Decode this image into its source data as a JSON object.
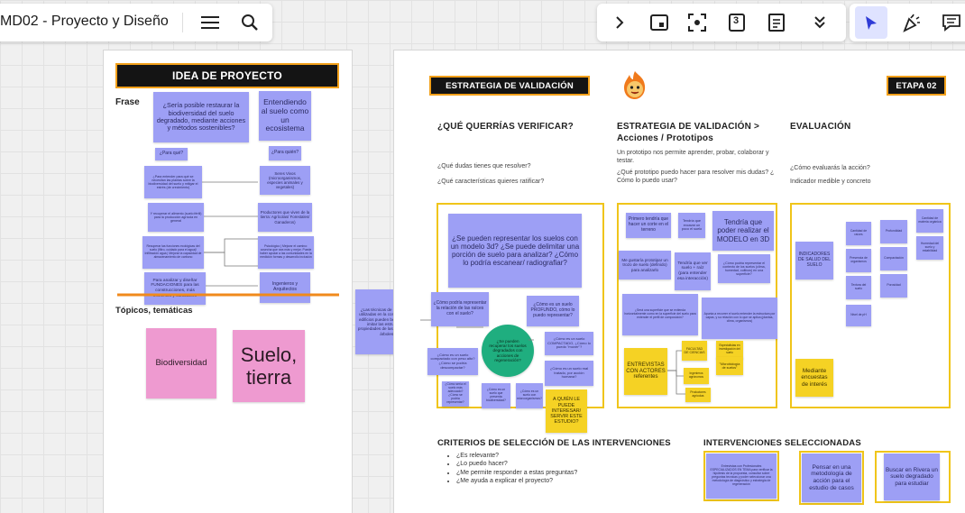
{
  "topbar": {
    "title": "MD02 - Proyecto y Diseño",
    "menu_icon": "hamburger-icon",
    "search_icon": "search-icon"
  },
  "toolbar": {
    "icons": [
      "chevron-right-icon",
      "frame-icon",
      "focus-icon",
      "counter-icon",
      "notes-icon",
      "double-chevron-down-icon",
      "select-cursor-icon",
      "celebrate-icon",
      "comments-icon"
    ],
    "counter_value": "3",
    "active_color": "#dfe3ff"
  },
  "colors": {
    "sticky_purple": "#9d9ff5",
    "sticky_yellow": "#f5d224",
    "sticky_pink": "#ee9ad0",
    "frame_border": "#f0c51a",
    "header_bg": "#141414",
    "header_border": "#f2a01a",
    "orange_line": "#f08a1c"
  },
  "left_frame": {
    "header": "IDEA DE PROYECTO",
    "frase_label": "Frase",
    "main_question": "¿Sería posible restaurar la biodiversidad del suelo degradado, mediante acciones y métodos sostenibles?",
    "main_answer": "Entendiendo al suelo como un ecosistema",
    "para_que": "¿Para qué?",
    "para_quien": "¿Para quién?",
    "left_notes": [
      "¿Para entender para qué se necesitan las plantas sobre la biodiversidad del suelo y mitigar el estrés (de crecimiento)",
      "Y recuperar el alimento (suelo fértil) para la producción agrícola en general",
      "Recuperar las funciones ecológicas del suelo (filtro, cuidado para el agua)/ Infiltración agua | Mejorar la capacidad de almacenamiento de carbono",
      "Para analizar y diseñar FUNDACIONES para las construcciones, más eficientes y saludables"
    ],
    "right_notes": [
      "Seres Vivos (microorganismos, especies animales y vegetales)",
      "Productores que viven de la tierra: Agrícolas/ Forestales/ Ganaderos)",
      "Psicológico | Mejorar el camino: cosecha que sea más y mejor. Puede haber ayudar a las comunidades en la medición formas y desarrollo inclusión",
      "Ingenieros y Arquitectos"
    ],
    "topicos_label": "Tópicos, temáticas",
    "topic_1": "Biodiversidad",
    "topic_2": "Suelo, tierra"
  },
  "floating_note": "¿Las técnicas de cimentación utilizadas en la construcción de edificios pueden beneficiarse al imitar las estructuras y propiedades de las raíces de los árboles?",
  "right_frame": {
    "header": "ESTRATEGIA DE VALIDACIÓN",
    "stage": "ETAPA 02",
    "mascot_icon": "fire-mascot-icon",
    "col1_title": "¿QUÉ QUERRÍAS VERIFICAR?",
    "col1_q1": "¿Qué dudas tienes que resolver?",
    "col1_q2": "¿Qué características quieres ratificar?",
    "col2_title": "ESTRATEGIA DE VALIDACIÓN > Acciones / Prototipos",
    "col2_desc": "Un prototipo nos permite aprender, probar, colaborar y testar.",
    "col2_q": "¿Qué prototipo puedo hacer para resolver mis dudas? ¿ Cómo lo puedo usar?",
    "col3_title": "EVALUACIÓN",
    "col3_q1": "¿Cómo evaluarás la acción?",
    "col3_q2": "Indicador medible y concreto",
    "verify_main": "¿Se pueden representar los suelos con un modelo 3d? ¿Se puede delimitar una porción de suelo para analizar? ¿Cómo lo podría escanear/ radiografiar?",
    "verify_notes": [
      "¿Cómo podría representar la relación de las raíces con el suelo?",
      "¿Cómo es un suelo PROFUNDO, cómo lo puedo representar?",
      "¿Cómo es un suelo compactado con peso alto? ¿Cómo se podría descompactar?",
      "¿Cómo es un suelo COMPACTADO, ¿Cómo lo puedo \"mover\"?",
      "¿Cómo es un suelo mal tratado, por acción humana?",
      "¿Cómo sería el suelo más adecuado? ¿Cómo se podría representar?",
      "¿Cómo es un suelo que presenta biodiversidad?",
      "¿Cómo es un suelo con microorganismos?"
    ],
    "verify_circle": "¿Se pueden recuperar los suelos degradados con acciones de regeneración?",
    "verify_yellow": "A QUIÉN LE PUEDE INTERESAR/ SERVIR ESTE ESTUDIO?",
    "proto_notes": [
      "Primero tendría que hacer un corte en el terreno",
      "Tendría que excavar un poco el suelo",
      "Tendría que poder realizar el MODELO en 3D",
      "Me gustaría prototipar un trozo de suelo (definido) para analizarlo",
      "Tendría que ver suelo + raíz (para entender esa interacción)",
      "¿Cómo podría representar el contexto de los suelos (clima, humedad, cultivos) en una superficie?",
      "¿Será una superficie que se extienda horizontalmente como en la superficie del suelo para entender el perfil de composición?",
      "Apunta a recorrer el suelo entender la estructura por capas, y su relación con lo que se aplica (plantas, clima, organismos)"
    ],
    "proto_yellow": [
      "ENTREVISTAS CON ACTORES referentes",
      "FACULTAD DE CIENCIAS",
      "Especialistas en investigación del suelo",
      "Ingenieros agrónomos",
      "\"Microbiología de suelos\"",
      "Productores agrícolas"
    ],
    "eval_notes": [
      "INDICADORES DE SALUD DEL SUELO",
      "Cantidad de raíces",
      "Presencia de organismos",
      "Textura del suelo",
      "Profundidad",
      "Compactación",
      "Porosidad",
      "Cantidad de materia orgánica",
      "Humedad del suelo y estabilidad",
      "Nivel de pH"
    ],
    "eval_yellow": "Mediante encuestas de interés",
    "criteria_title": "CRITERIOS DE SELECCIÓN DE LAS INTERVENCIONES",
    "criteria": [
      "¿Es relevante?",
      "¿Lo puedo hacer?",
      "¿Me permite responder a estas preguntas?",
      "¿Me ayuda a explicar el proyecto?"
    ],
    "selected_title": "INTERVENCIONES SELECCIONADAS",
    "selected": [
      "Entrevistas con Profesionales ESPECIALIZADOS EN TEMA para verificar la hipótesis de la propuesta, consultar sobre preguntas tecnicas y poder seleccionar una metodología de diagnóstico y estrategia de regeneración",
      "Pensar en una metodología de acción para el estudio de casos",
      "Buscar en Rivera un suelo degradado para estudiar"
    ]
  }
}
